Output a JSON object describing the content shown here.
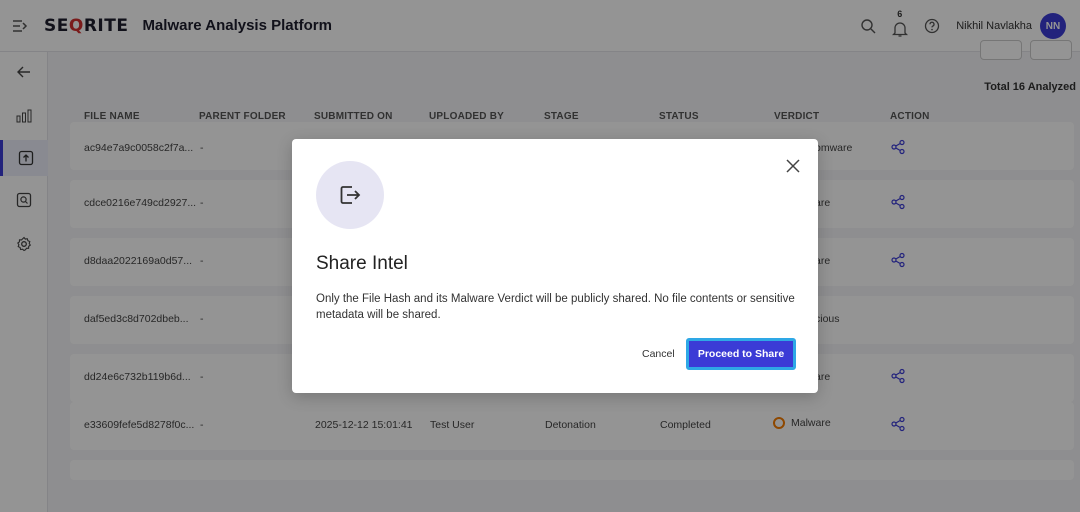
{
  "header": {
    "brand": "SEQRITE",
    "app_title": "Malware Analysis Platform",
    "notification_count": "6",
    "user_name": "Nikhil Navlakha",
    "user_initials": "NN"
  },
  "summary": {
    "total_label": "Total 16 Analyzed"
  },
  "table": {
    "columns": [
      "FILE NAME",
      "PARENT FOLDER",
      "SUBMITTED ON",
      "UPLOADED BY",
      "STAGE",
      "STATUS",
      "VERDICT",
      "ACTION"
    ],
    "rows": [
      {
        "file_name": "ac94e7a9c0058c2f7a...",
        "parent_folder": "-",
        "submitted_on": "",
        "uploaded_by": "",
        "stage": "",
        "status": "",
        "verdict": "omware"
      },
      {
        "file_name": "cdce0216e749cd2927...",
        "parent_folder": "-",
        "submitted_on": "",
        "uploaded_by": "",
        "stage": "",
        "status": "",
        "verdict": "are"
      },
      {
        "file_name": "d8daa2022169a0d57...",
        "parent_folder": "-",
        "submitted_on": "",
        "uploaded_by": "",
        "stage": "",
        "status": "",
        "verdict": "are"
      },
      {
        "file_name": "daf5ed3c8d702dbeb...",
        "parent_folder": "-",
        "submitted_on": "",
        "uploaded_by": "",
        "stage": "",
        "status": "",
        "verdict": "cious"
      },
      {
        "file_name": "dd24e6c732b119b6d...",
        "parent_folder": "-",
        "submitted_on": "",
        "uploaded_by": "",
        "stage": "",
        "status": "",
        "verdict": "are"
      },
      {
        "file_name": "e33609fefe5d8278f0c...",
        "parent_folder": "-",
        "submitted_on": "2025-12-12 15:01:41",
        "uploaded_by": "Test User",
        "stage": "Detonation",
        "status": "Completed",
        "verdict": "Malware"
      }
    ]
  },
  "modal": {
    "title": "Share Intel",
    "description": "Only the File Hash and its Malware Verdict will be publicly shared. No file contents or sensitive metadata will be shared.",
    "cancel_label": "Cancel",
    "proceed_label": "Proceed to Share"
  },
  "colors": {
    "accent": "#3b3bd6",
    "brand_red": "#d32f2f",
    "verdict_malware": "#f57c00",
    "focus_ring": "#2ea8e6"
  },
  "icons": {
    "menu": "menu-toggle-icon",
    "back": "arrow-left-icon",
    "dashboard": "bar-chart-icon",
    "upload": "upload-icon",
    "analysis": "search-document-icon",
    "settings": "gear-icon",
    "search": "search-icon",
    "bell": "bell-icon",
    "help": "help-icon",
    "share": "share-icon",
    "export": "export-icon",
    "close": "close-icon"
  }
}
